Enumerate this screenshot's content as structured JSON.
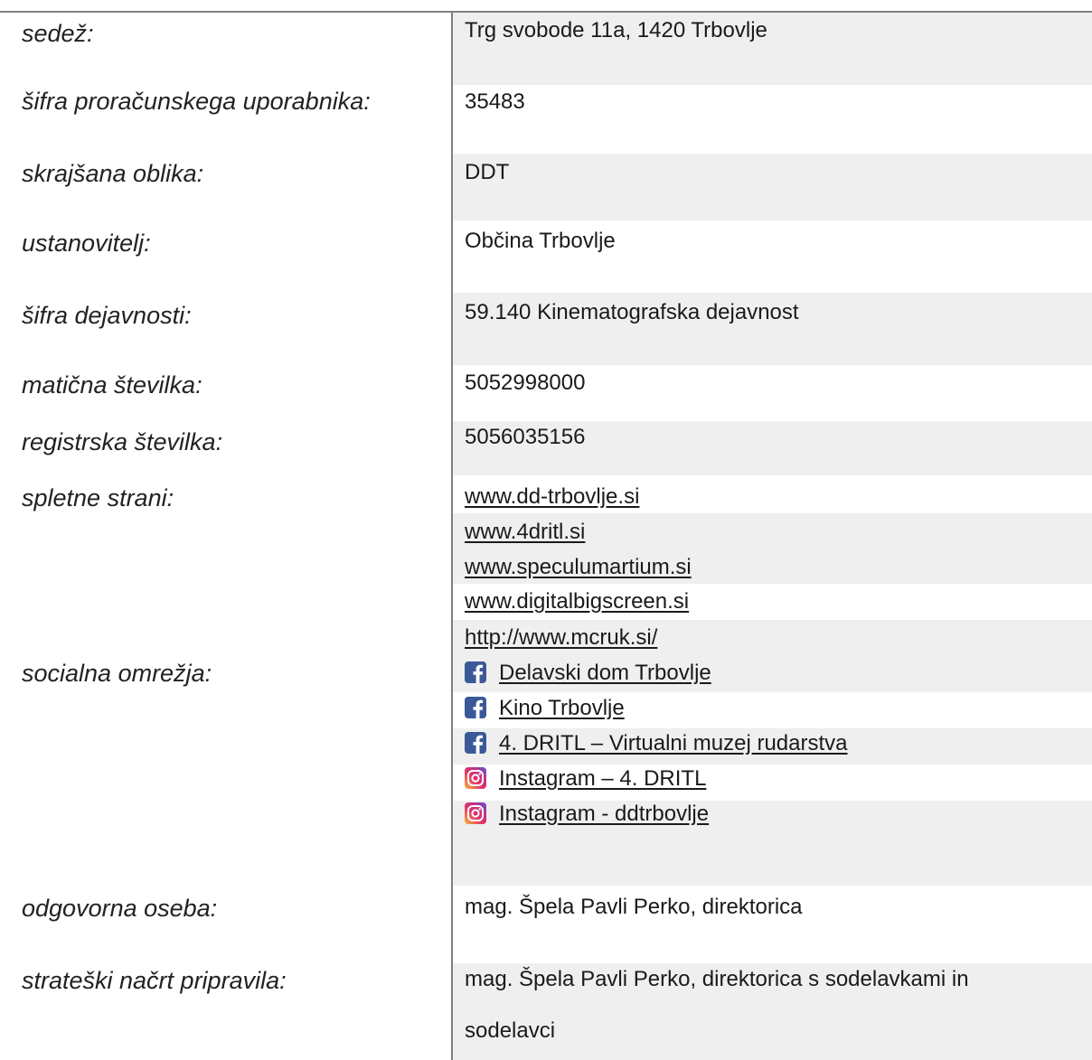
{
  "rows": {
    "sedez": {
      "label": "sedež:",
      "value": "Trg svobode 11a, 1420 Trbovlje"
    },
    "sifra_pu": {
      "label": "šifra proračunskega uporabnika:",
      "value": "35483"
    },
    "skrajsana": {
      "label": "skrajšana oblika:",
      "value": "DDT"
    },
    "ustanovitelj": {
      "label": "ustanovitelj:",
      "value": "Občina Trbovlje"
    },
    "sifra_dej": {
      "label": "šifra dejavnosti:",
      "value": "59.140 Kinematografska dejavnost"
    },
    "maticna": {
      "label": "matična številka:",
      "value": "5052998000"
    },
    "registrska": {
      "label": "registrska številka:",
      "value": "5056035156"
    },
    "spletne": {
      "label": "spletne strani:"
    },
    "socialna": {
      "label": "socialna omrežja:"
    },
    "odgovorna": {
      "label": "odgovorna oseba:",
      "value": "mag. Špela Pavli Perko, direktorica"
    },
    "strateski": {
      "label": "strateški načrt pripravila:",
      "value_line1": "mag. Špela Pavli Perko, direktorica s sodelavkami in",
      "value_line2": "sodelavci"
    }
  },
  "websites": [
    "www.dd-trbovlje.si",
    "www.4dritl.si",
    "www.speculumartium.si",
    "www.digitalbigscreen.si",
    "http://www.mcruk.si/"
  ],
  "social": [
    {
      "icon": "facebook-icon",
      "text": "Delavski dom Trbovlje"
    },
    {
      "icon": "facebook-icon",
      "text": "Kino Trbovlje"
    },
    {
      "icon": "facebook-icon",
      "text": "4. DRITL – Virtualni muzej rudarstva"
    },
    {
      "icon": "instagram-icon",
      "text": "Instagram – 4. DRITL"
    },
    {
      "icon": "instagram-icon",
      "text": "Instagram - ddtrbovlje"
    }
  ],
  "colors": {
    "cell_background": "#efefef",
    "border": "#808080",
    "facebook": "#3b5998"
  }
}
